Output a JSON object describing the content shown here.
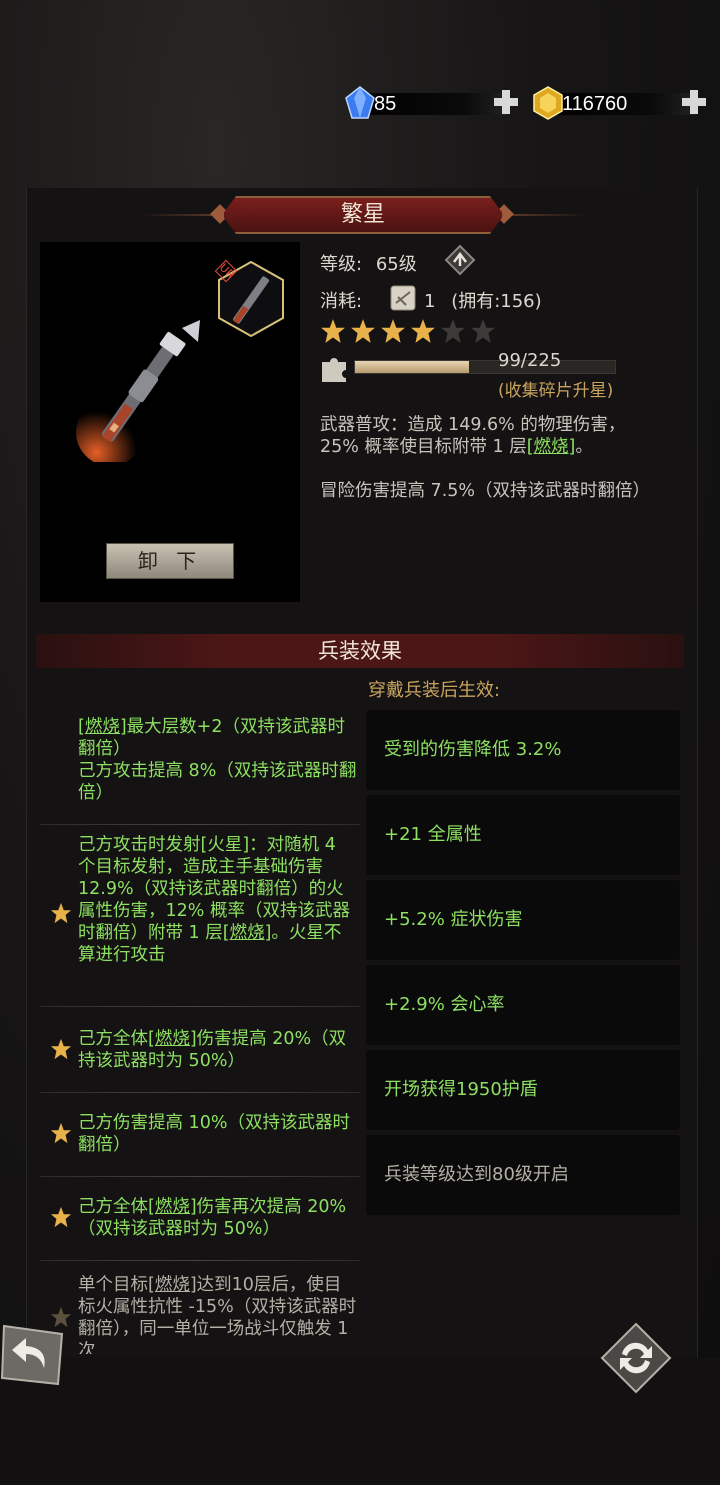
{
  "currency": {
    "gem": {
      "value": "85",
      "icon": "blue-gem-icon"
    },
    "gold": {
      "value": "116760",
      "icon": "gold-coin-icon"
    }
  },
  "weapon": {
    "name": "繁星",
    "rarity": "UR",
    "unequip_label": "卸 下",
    "level_label": "等级:",
    "level_value": "65级",
    "cost_label": "消耗:",
    "cost_value": "1",
    "owned": "(拥有:156)",
    "stars_filled": 4,
    "stars_total": 6,
    "fragments": "99/225",
    "fragments_progress": 0.44,
    "fragments_hint": "(收集碎片升星)",
    "attack_desc_1": "武器普攻：造成 149.6% 的物理伤害，",
    "attack_desc_2a": "25% 概率使目标附带 1 层",
    "attack_desc_2b": "[燃烧]",
    "attack_desc_2c": "。",
    "bonus_desc": "冒险伤害提高 7.5%（双持该武器时翻倍）"
  },
  "effects": {
    "header": "兵装效果",
    "subtitle": "穿戴兵装后生效:",
    "left": [
      {
        "text_a": "[燃烧]",
        "text_b": "最大层数+2（双持该武器时翻倍）",
        "text_c": "己方攻击提高 8%（双持该武器时翻倍）",
        "star": false
      },
      {
        "text": "己方攻击时发射[火星]：对随机 4 个目标发射，造成主手基础伤害 12.9%（双持该武器时翻倍）的火属性伤害，12% 概率（双持该武器时翻倍）附带 1 层",
        "link": "[燃烧]",
        "tail": "。火星不算进行攻击",
        "star": true
      },
      {
        "pre": "己方全体",
        "link": "[燃烧]",
        "text": "伤害提高 20%（双持该武器时为 50%）",
        "star": true
      },
      {
        "text": "己方伤害提高 10%（双持该武器时翻倍）",
        "star": true
      },
      {
        "pre": "己方全体",
        "link": "[燃烧]",
        "text": "伤害再次提高 20%（双持该武器时为 50%）",
        "star": true
      },
      {
        "pre": "单个目标",
        "link": "[燃烧]",
        "text": "达到10层后，使目标火属性抗性 -15%（双持该武器时翻倍），同一单位一场战斗仅触发 1 次",
        "star": true
      }
    ],
    "right": [
      "受到的伤害降低 3.2%",
      "+21 全属性",
      "+5.2% 症状伤害",
      "+2.9% 会心率",
      "开场获得1950护盾",
      "兵装等级达到80级开启"
    ]
  },
  "colors": {
    "accent_green": "#8de062",
    "title_red": "#7a1f1c",
    "gold_text": "#c9a45f"
  }
}
